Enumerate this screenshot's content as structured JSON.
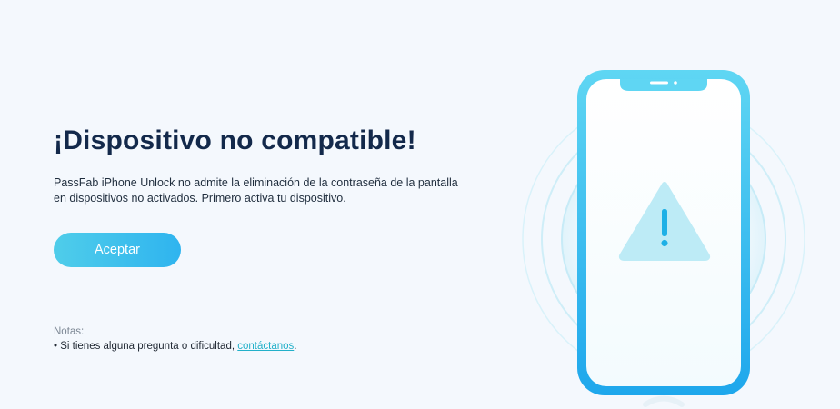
{
  "dialog": {
    "title": "¡Dispositivo no compatible!",
    "description_line1": "PassFab iPhone Unlock no admite la eliminación de la contraseña de la pantalla",
    "description_line2": "en dispositivos no activados. Primero activa tu dispositivo.",
    "accept_label": "Aceptar"
  },
  "notes": {
    "title": "Notas:",
    "bullet": "•",
    "text_before_link": "Si tienes alguna pregunta o dificultad,",
    "link_label": "contáctanos",
    "text_after_link": "."
  },
  "illustration": {
    "phone_icon": "phone-icon",
    "warning_icon": "warning-triangle-icon",
    "colors": {
      "phone_frame": "#2fbdf0",
      "screen": "#ffffff",
      "warning": "#bdebf6",
      "rings": "#cfeef8",
      "title": "#13294b",
      "accent_button": "#35b8ee",
      "link": "#22b0c9"
    }
  }
}
